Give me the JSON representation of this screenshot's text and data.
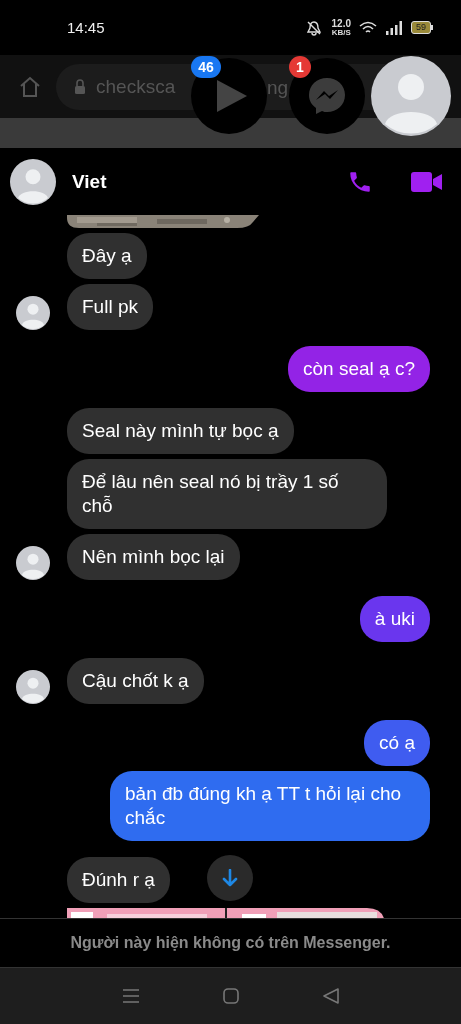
{
  "status_bar": {
    "time": "14:45",
    "speed_value": "12.0",
    "speed_unit": "KB/S",
    "battery": "59"
  },
  "browser": {
    "url_parts": [
      "checksca",
      "ng"
    ]
  },
  "chat_heads": [
    {
      "kind": "video",
      "badge": "46",
      "color": "#1877f2"
    },
    {
      "kind": "messenger",
      "badge": "1",
      "color": "#e53935"
    },
    {
      "kind": "avatar"
    }
  ],
  "chat": {
    "contact_name": "Viet",
    "messages": [
      {
        "kind": "incoming_picture",
        "avatar": false
      },
      {
        "kind": "incoming_text",
        "avatar": false,
        "text": "Đây ạ"
      },
      {
        "kind": "incoming_text",
        "avatar": true,
        "text": "Full pk"
      },
      {
        "kind": "outgoing_text",
        "text": "còn seal ạ c?",
        "color": "#9323e6"
      },
      {
        "kind": "incoming_text",
        "avatar": false,
        "text": "Seal này mình tự bọc ạ"
      },
      {
        "kind": "incoming_text",
        "avatar": false,
        "text": "Để lâu nên seal nó bị trầy 1 số chỗ"
      },
      {
        "kind": "incoming_text",
        "avatar": true,
        "text": "Nên mình bọc lại"
      },
      {
        "kind": "outgoing_text",
        "text": "à uki",
        "color": "#6a36ee"
      },
      {
        "kind": "incoming_text",
        "avatar": true,
        "text": "Cậu chốt k ạ"
      },
      {
        "kind": "outgoing_text",
        "text": "có ạ",
        "color": "#3f5cf0"
      },
      {
        "kind": "outgoing_text",
        "text": "bản đb đúng kh ạ TT t hỏi lại cho chắc",
        "color": "#2f6cf0"
      },
      {
        "kind": "incoming_text",
        "avatar": false,
        "text": "Đúnh r ạ"
      },
      {
        "kind": "incoming_picture",
        "avatar": false
      }
    ],
    "notice": "Người này hiện không có trên Messenger."
  }
}
